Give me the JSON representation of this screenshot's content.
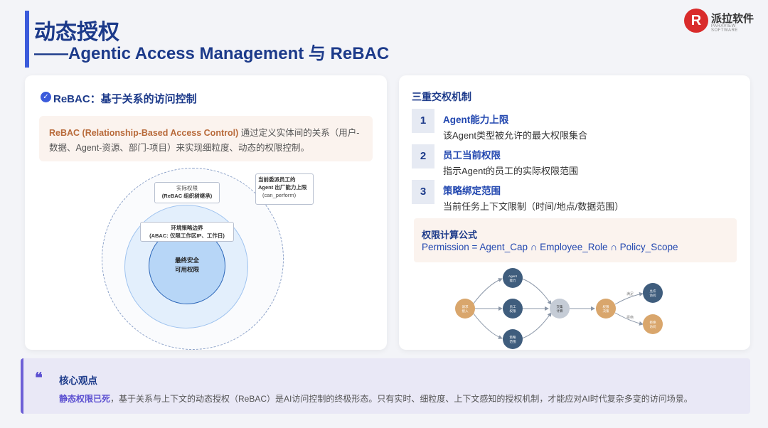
{
  "header": {
    "title": "动态授权",
    "subtitle": "——Agentic Access Management 与 ReBAC"
  },
  "logo": {
    "mark": "R",
    "name": "派拉软件",
    "tagline": "PARAVIEW SOFTWARE"
  },
  "left": {
    "heading": "ReBAC：基于关系的访问控制",
    "definition_strong": "ReBAC (Relationship-Based Access Control)",
    "definition_rest": " 通过定义实体间的关系（用户-数据、Agent-资源、部门-项目）来实现细粒度、动态的权限控制。",
    "diagram": {
      "actual_title": "实际权限",
      "actual_sub": "(ReBAC 组织树继承)",
      "env_title": "环境策略边界",
      "env_sub": "(ABAC: 仅限工作区IP、工作日)",
      "core_line1": "最终安全",
      "core_line2": "可用权限",
      "agent_line1": "当前委派员工的",
      "agent_line2": "Agent 出厂能力上限",
      "agent_line3": "(can_perform)"
    }
  },
  "right": {
    "heading": "三重交权机制",
    "items": [
      {
        "num": "1",
        "title": "Agent能力上限",
        "desc": "该Agent类型被允许的最大权限集合"
      },
      {
        "num": "2",
        "title": "员工当前权限",
        "desc": "指示Agent的员工的实际权限范围"
      },
      {
        "num": "3",
        "title": "策略绑定范围",
        "desc": "当前任务上下文限制（时间/地点/数据范围）"
      }
    ],
    "formula_title": "权限计算公式",
    "formula": "Permission = Agent_Cap ∩ Employee_Role ∩ Policy_Scope",
    "flow": {
      "start": [
        "请求",
        "接入"
      ],
      "agent": [
        "Agent",
        "能力"
      ],
      "employee": [
        "员工",
        "权限"
      ],
      "policy": [
        "策略",
        "范围"
      ],
      "compute": [
        "交集",
        "计算"
      ],
      "decision": [
        "权限",
        "决策"
      ],
      "allow": [
        "允许",
        "访问"
      ],
      "deny": [
        "拒绝",
        "访问"
      ],
      "allow_edge": "满足",
      "deny_edge": "拒绝"
    }
  },
  "bottom": {
    "heading": "核心观点",
    "strong": "静态权限已死",
    "rest": "，基于关系与上下文的动态授权（ReBAC）是AI访问控制的终极形态。只有实时、细粒度、上下文感知的授权机制，才能应对AI时代复杂多变的访问场景。"
  },
  "colors": {
    "accent": "#1c3a8a",
    "bar": "#3b5bdb",
    "node_blue": "#3f5d7d",
    "node_orange": "#d9a66c",
    "node_grey": "#c5ccd6",
    "quote_purple": "#5b4fd1"
  }
}
